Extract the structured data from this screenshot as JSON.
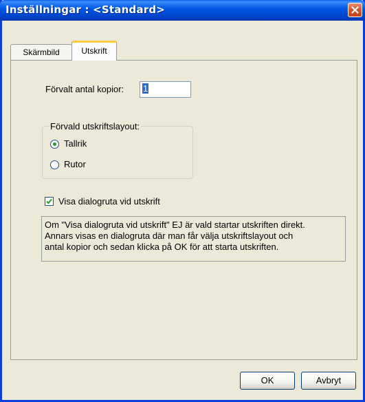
{
  "window": {
    "title": "Inställningar : <Standard>"
  },
  "tabs": [
    {
      "label": "Skärmbild",
      "active": false
    },
    {
      "label": "Utskrift",
      "active": true
    }
  ],
  "copies": {
    "label": "Förvalt antal kopior:",
    "value": "1"
  },
  "layout_group": {
    "legend": "Förvald utskriftslayout:",
    "options": [
      {
        "label": "Tallrik",
        "selected": true
      },
      {
        "label": "Rutor",
        "selected": false
      }
    ]
  },
  "show_dialog": {
    "label": "Visa dialogruta vid utskrift",
    "checked": true
  },
  "info_text": "Om \"Visa dialogruta vid utskrift\" EJ är vald startar utskriften direkt.\nAnnars visas en dialogruta där man får välja utskriftslayout och\nantal kopior och sedan klicka på OK för att starta utskriften.",
  "buttons": {
    "ok": "OK",
    "cancel": "Avbryt"
  },
  "colors": {
    "title_bar": "#0058e6",
    "close_button": "#d8562e",
    "dialog_bg": "#ece9d8",
    "selection": "#316ac5"
  }
}
